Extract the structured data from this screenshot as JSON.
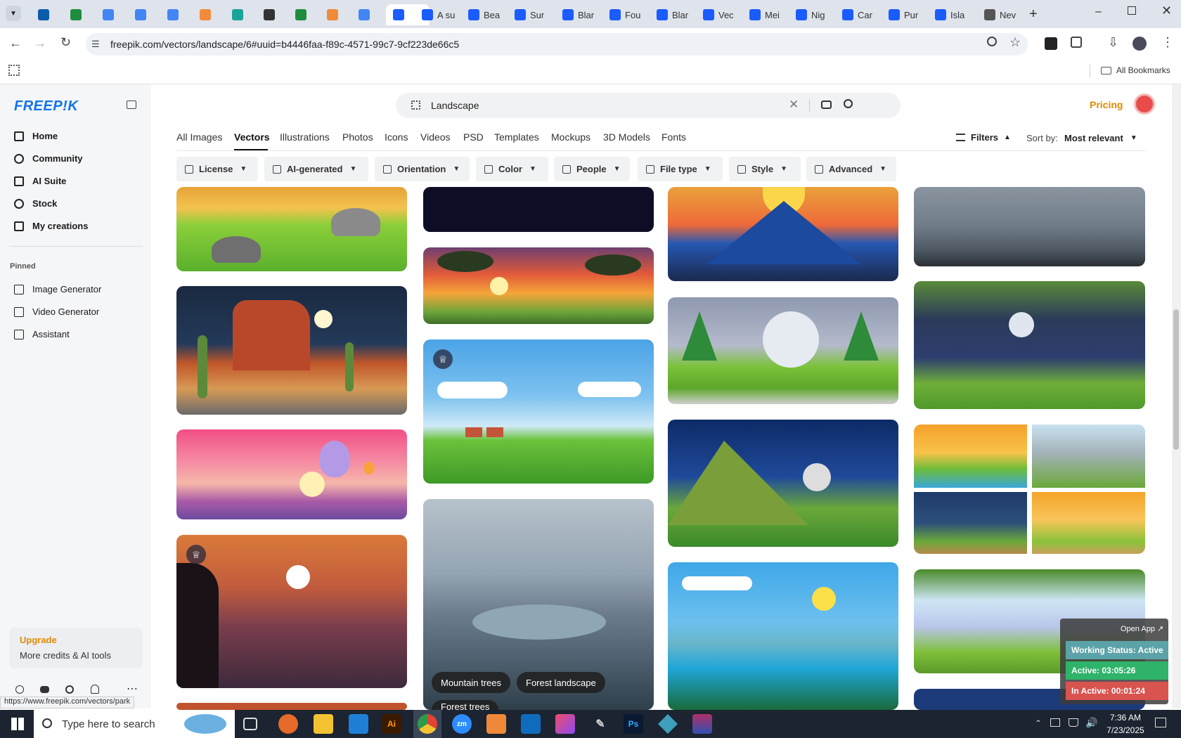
{
  "browser": {
    "tabs": [
      {
        "label": "",
        "color": "#0b5cab"
      },
      {
        "label": "",
        "color": "#1e8e3e"
      },
      {
        "label": "",
        "color": "#4285f4"
      },
      {
        "label": "",
        "color": "#4285f4"
      },
      {
        "label": "",
        "color": "#4285f4"
      },
      {
        "label": "",
        "color": "#f28b39"
      },
      {
        "label": "",
        "color": "#1aa39a"
      },
      {
        "label": "",
        "color": "#333333"
      },
      {
        "label": "",
        "color": "#1e8e3e"
      },
      {
        "label": "",
        "color": "#f28b39"
      },
      {
        "label": "",
        "color": "#4285f4"
      },
      {
        "label": "",
        "color": "#1a5cff"
      },
      {
        "label": "A su",
        "color": "#1a5cff"
      },
      {
        "label": "Bea",
        "color": "#1a5cff"
      },
      {
        "label": "Sur",
        "color": "#1a5cff"
      },
      {
        "label": "Blar",
        "color": "#1a5cff"
      },
      {
        "label": "Fou",
        "color": "#1a5cff"
      },
      {
        "label": "Blar",
        "color": "#1a5cff"
      },
      {
        "label": "Vec",
        "color": "#1a5cff"
      },
      {
        "label": "Mei",
        "color": "#1a5cff"
      },
      {
        "label": "Nig",
        "color": "#1a5cff"
      },
      {
        "label": "Car",
        "color": "#1a5cff"
      },
      {
        "label": "Pur",
        "color": "#1a5cff"
      },
      {
        "label": "Isla",
        "color": "#1a5cff"
      },
      {
        "label": "Nev",
        "color": "#555555"
      }
    ],
    "url": "freepik.com/vectors/landscape/6#uuid=b4446faa-f89c-4571-99c7-9cf223de66c5",
    "bookmarks_label": "All Bookmarks",
    "status_url": "https://www.freepik.com/vectors/park"
  },
  "sidebar": {
    "logo": "FREEP!K",
    "nav": [
      {
        "label": "Home",
        "icon": "home-icon"
      },
      {
        "label": "Community",
        "icon": "globe-icon"
      },
      {
        "label": "AI Suite",
        "icon": "sparkle-icon"
      },
      {
        "label": "Stock",
        "icon": "search-icon"
      },
      {
        "label": "My creations",
        "icon": "folder-icon"
      }
    ],
    "pinned_heading": "Pinned",
    "pinned": [
      {
        "label": "Image Generator",
        "icon": "image-icon"
      },
      {
        "label": "Video Generator",
        "icon": "video-icon"
      },
      {
        "label": "Assistant",
        "icon": "chat-icon"
      }
    ],
    "upgrade_title": "Upgrade",
    "upgrade_sub": "More credits & AI tools"
  },
  "header": {
    "search_value": "Landscape",
    "pricing": "Pricing"
  },
  "categories": [
    "All Images",
    "Vectors",
    "Illustrations",
    "Photos",
    "Icons",
    "Videos",
    "PSD",
    "Templates",
    "Mockups",
    "3D Models",
    "Fonts"
  ],
  "active_category": "Vectors",
  "filters_label": "Filters",
  "sort_label": "Sort by:",
  "sort_value": "Most relevant",
  "chips": [
    "License",
    "AI-generated",
    "Orientation",
    "Color",
    "People",
    "File type",
    "Style",
    "Advanced"
  ],
  "tag_chips": [
    "Mountain trees",
    "Forest landscape",
    "Forest trees"
  ],
  "status_widget": {
    "open_app": "Open App ↗",
    "working": "Working Status: Active",
    "active": "Active: 03:05:26",
    "inactive": "In Active: 00:01:24"
  },
  "taskbar": {
    "search_placeholder": "Type here to search",
    "time": "7:36 AM",
    "date": "7/23/2025"
  }
}
